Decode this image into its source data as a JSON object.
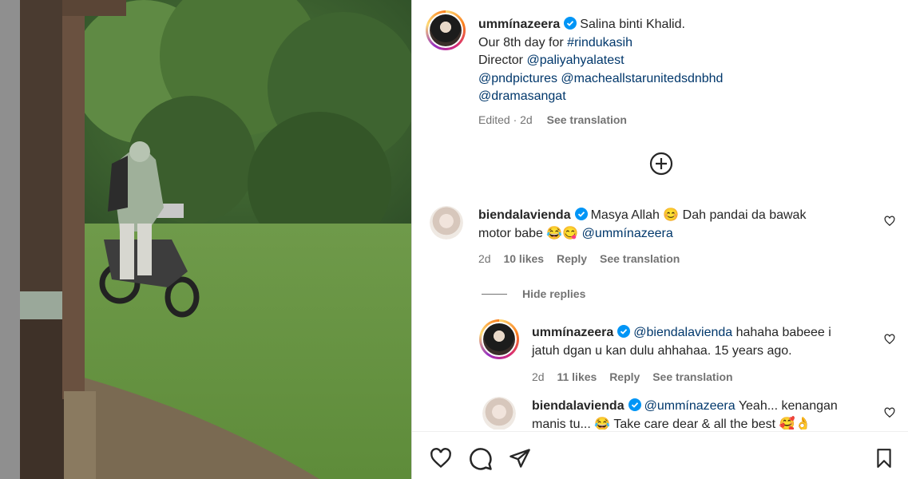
{
  "post": {
    "author": "ummínazeera",
    "caption_line1": "Salina binti Khalid.",
    "caption_line2_text": "Our 8th day for ",
    "caption_line2_tag": "#rindukasih",
    "caption_line3_text": "Director ",
    "caption_line3_mention": "@paliyahyalatest",
    "caption_line4_mention1": "@pndpictures",
    "caption_line4_mention2": "@macheallstarunitedsdnbhd",
    "caption_line5_mention": "@dramasangat",
    "edited": "Edited · 2d",
    "see_translation": "See translation"
  },
  "comments": [
    {
      "author": "biendalavienda",
      "text1": "Masya Allah 😊 Dah pandai da bawak",
      "text2": "motor babe 😂😋 ",
      "mention": "@ummínazeera",
      "time": "2d",
      "likes": "10 likes",
      "reply": "Reply",
      "see_translation": "See translation"
    }
  ],
  "hide_replies": "Hide replies",
  "replies": [
    {
      "author": "ummínazeera",
      "mention": "@biendalavienda",
      "text1": " hahaha babeee i",
      "text2": "jatuh dgan u kan dulu ahhahaa. 15 years ago.",
      "time": "2d",
      "likes": "11 likes",
      "reply": "Reply",
      "see_translation": "See translation"
    },
    {
      "author": "biendalavienda",
      "mention": "@ummínazeera",
      "text1": " Yeah... kenangan",
      "text2": "manis tu... 😂 Take care dear & all the best 🥰👌"
    }
  ],
  "icons": {
    "verified_color": "#0095f6",
    "add": "plus-circle-icon",
    "like": "heart-icon",
    "comment": "comment-icon",
    "share": "share-icon",
    "save": "bookmark-icon"
  }
}
